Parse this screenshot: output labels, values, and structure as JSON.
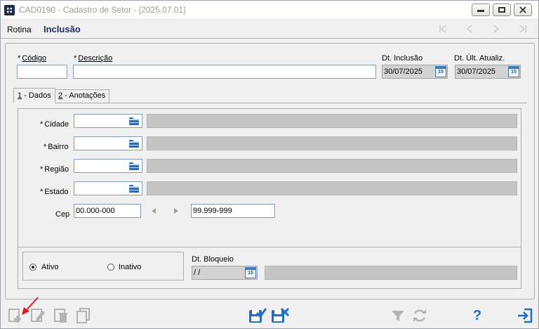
{
  "window": {
    "title": "CAD0190 - Cadastro de Setor - [2025.07.01]"
  },
  "menubar": {
    "rotina_label": "Rotina",
    "mode_label": "Inclusão"
  },
  "header": {
    "codigo": {
      "required_mark": "*",
      "label": "Código",
      "value": ""
    },
    "descricao": {
      "required_mark": "*",
      "label": "Descrição",
      "value": ""
    },
    "dt_inclusao": {
      "label": "Dt. Inclusão",
      "value": "30/07/2025"
    },
    "dt_ult_atualiz": {
      "label": "Dt. Últ. Atualiz.",
      "value": "30/07/2025"
    }
  },
  "tabs": [
    {
      "number": "1",
      "label": " - Dados"
    },
    {
      "number": "2",
      "label": " - Anotações"
    }
  ],
  "fields": {
    "cidade": {
      "required_mark": "*",
      "label": "Cidade",
      "value": "",
      "description": ""
    },
    "bairro": {
      "required_mark": "*",
      "label": "Bairro",
      "value": "",
      "description": ""
    },
    "regiao": {
      "required_mark": "*",
      "label": "Região",
      "value": "",
      "description": ""
    },
    "estado": {
      "required_mark": "*",
      "label": "Estado",
      "value": "",
      "description": ""
    },
    "cep": {
      "label": "Cep",
      "from": "00.000-000",
      "to": "99.999-999"
    }
  },
  "status": {
    "ativo_label": "Ativo",
    "inativo_label": "Inativo",
    "selected": "Ativo",
    "dt_bloqueio": {
      "label": "Dt. Bloqueio",
      "value": "/ /",
      "description": ""
    }
  },
  "calendar_icon_text": "15",
  "colors": {
    "accent_blue": "#1d6fc7",
    "mode_label": "#1d2c6b",
    "annotation_red": "#e0161b",
    "disabled_grey": "#c5c5c5"
  },
  "toolbar": {
    "left_icons": [
      "add-icon",
      "edit-icon",
      "delete-icon",
      "copy-icon"
    ],
    "center_icons": [
      "save-confirm-icon",
      "save-cancel-icon"
    ],
    "right_icons": [
      "filter-icon",
      "refresh-icon",
      "help-icon",
      "exit-icon"
    ],
    "help_glyph": "?"
  }
}
